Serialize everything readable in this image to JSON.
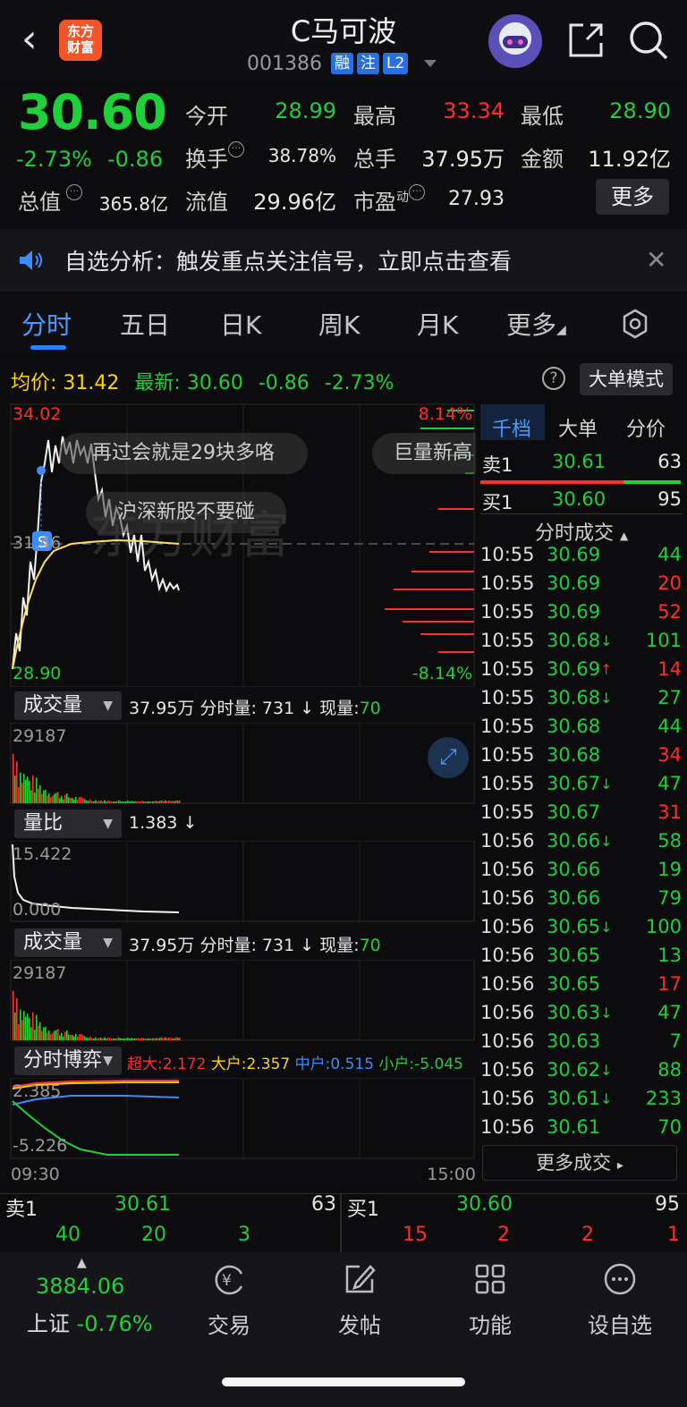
{
  "header": {
    "title": "C马可波",
    "code": "001386",
    "tags": [
      "融",
      "注",
      "L2"
    ],
    "logo_line1": "东方",
    "logo_line2": "财富"
  },
  "quote": {
    "last": "30.60",
    "chg_pct": "-2.73%",
    "chg_val": "-0.86",
    "open_label": "今开",
    "open": "28.99",
    "high_label": "最高",
    "high": "33.34",
    "low_label": "最低",
    "low": "28.90",
    "turnover_label": "换手",
    "turnover": "38.78%",
    "volume_label": "总手",
    "volume": "37.95万",
    "amount_label": "金额",
    "amount": "11.92亿",
    "mktcap_label": "总值",
    "mktcap": "365.8亿",
    "float_label": "流值",
    "float": "29.96亿",
    "pe_label": "市盈",
    "pe_sup": "动",
    "pe": "27.93",
    "more_label": "更多"
  },
  "banner": {
    "text": "自选分析：触发重点关注信号，立即点击查看"
  },
  "tabs": [
    "分时",
    "五日",
    "日K",
    "周K",
    "月K",
    "更多"
  ],
  "avg_row": {
    "avg_label": "均价:",
    "avg": "31.42",
    "latest_label": "最新:",
    "latest": "30.60",
    "chg": "-0.86",
    "pct": "-2.73%",
    "bigorder_label": "大单模式"
  },
  "chart": {
    "price_max": "34.02",
    "price_min": "28.90",
    "price_mid": "31.46",
    "pct_max": "8.14%",
    "pct_min": "-8.14%",
    "bubble1": "再过会就是29块多咯",
    "bubble2": "巨量新高",
    "bubble3": "沪深新股不要碰",
    "watermark": "东方财富",
    "marker": "S",
    "time_start": "09:30",
    "time_end": "15:00"
  },
  "indicators": {
    "vol1_label": "成交量",
    "vol1_total": "37.95万",
    "vol1_tick_label": "分时量:",
    "vol1_tick": "731",
    "vol1_tick_arrow": "↓",
    "vol1_now_label": "现量:",
    "vol1_now": "70",
    "vol1_max": "29187",
    "ratio_label": "量比",
    "ratio_val": "1.383",
    "ratio_arrow": "↓",
    "ratio_max": "15.422",
    "ratio_min": "0.000",
    "vol2_label": "成交量",
    "vol2_total": "37.95万",
    "vol2_tick_label": "分时量:",
    "vol2_tick": "731",
    "vol2_tick_arrow": "↓",
    "vol2_now_label": "现量:",
    "vol2_now": "70",
    "vol2_max": "29187",
    "game_label": "分时博弈",
    "game_super": "超大:2.172",
    "game_big": "大户:2.357",
    "game_mid": "中户:0.515",
    "game_small": "小户:-5.045",
    "game_max": "2.385",
    "game_min": "-5.226"
  },
  "book": {
    "tabs": [
      "千档",
      "大单",
      "分价"
    ],
    "ask1_label": "卖1",
    "ask1_price": "30.61",
    "ask1_vol": "63",
    "bid1_label": "买1",
    "bid1_price": "30.60",
    "bid1_vol": "95",
    "ticks_title": "分时成交",
    "ticks": [
      {
        "t": "10:55",
        "p": "30.69",
        "a": "",
        "v": "44",
        "c": "green"
      },
      {
        "t": "10:55",
        "p": "30.69",
        "a": "",
        "v": "20",
        "c": "red"
      },
      {
        "t": "10:55",
        "p": "30.69",
        "a": "",
        "v": "52",
        "c": "red"
      },
      {
        "t": "10:55",
        "p": "30.68",
        "a": "↓",
        "v": "101",
        "c": "green"
      },
      {
        "t": "10:55",
        "p": "30.69",
        "a": "↑",
        "v": "14",
        "c": "red"
      },
      {
        "t": "10:55",
        "p": "30.68",
        "a": "↓",
        "v": "27",
        "c": "green"
      },
      {
        "t": "10:55",
        "p": "30.68",
        "a": "",
        "v": "44",
        "c": "green"
      },
      {
        "t": "10:55",
        "p": "30.68",
        "a": "",
        "v": "34",
        "c": "red"
      },
      {
        "t": "10:55",
        "p": "30.67",
        "a": "↓",
        "v": "47",
        "c": "green"
      },
      {
        "t": "10:55",
        "p": "30.67",
        "a": "",
        "v": "31",
        "c": "red"
      },
      {
        "t": "10:56",
        "p": "30.66",
        "a": "↓",
        "v": "58",
        "c": "green"
      },
      {
        "t": "10:56",
        "p": "30.66",
        "a": "",
        "v": "19",
        "c": "green"
      },
      {
        "t": "10:56",
        "p": "30.66",
        "a": "",
        "v": "79",
        "c": "green"
      },
      {
        "t": "10:56",
        "p": "30.65",
        "a": "↓",
        "v": "100",
        "c": "green"
      },
      {
        "t": "10:56",
        "p": "30.65",
        "a": "",
        "v": "13",
        "c": "green"
      },
      {
        "t": "10:56",
        "p": "30.65",
        "a": "",
        "v": "17",
        "c": "red"
      },
      {
        "t": "10:56",
        "p": "30.63",
        "a": "↓",
        "v": "47",
        "c": "green"
      },
      {
        "t": "10:56",
        "p": "30.63",
        "a": "",
        "v": "7",
        "c": "green"
      },
      {
        "t": "10:56",
        "p": "30.62",
        "a": "↓",
        "v": "88",
        "c": "green"
      },
      {
        "t": "10:56",
        "p": "30.61",
        "a": "↓",
        "v": "233",
        "c": "green"
      },
      {
        "t": "10:56",
        "p": "30.61",
        "a": "",
        "v": "70",
        "c": "green"
      }
    ],
    "more_ticks": "更多成交"
  },
  "bottom_quote": {
    "ask_label": "卖1",
    "ask_price": "30.61",
    "ask_vol": "63",
    "ask_queue": [
      "40",
      "20",
      "3"
    ],
    "bid_label": "买1",
    "bid_price": "30.60",
    "bid_vol": "95",
    "bid_queue": [
      "15",
      "2",
      "2",
      "1"
    ]
  },
  "nav": {
    "index_value": "3884.06",
    "index_name": "上证",
    "index_chg": "-0.76%",
    "items": [
      "交易",
      "发帖",
      "功能",
      "设自选"
    ]
  },
  "colors": {
    "up": "#ff2d2d",
    "down": "#1fd03a",
    "accent": "#2a82ff",
    "avg_line": "#ffe066"
  }
}
